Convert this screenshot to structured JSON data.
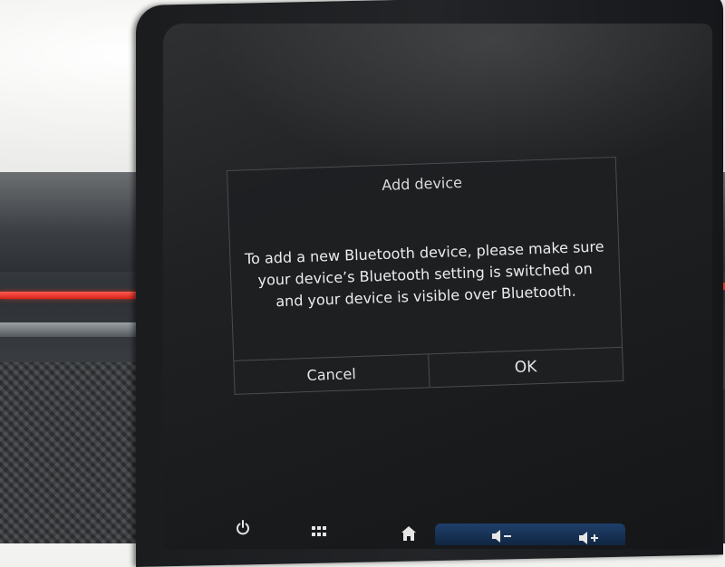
{
  "dialog": {
    "title": "Add device",
    "message": "To add a new Bluetooth device, please make sure your device’s Bluetooth setting is switched on and your device is visible over Bluetooth.",
    "cancel_label": "Cancel",
    "ok_label": "OK"
  },
  "bottom_bar": {
    "icons": [
      "power-icon",
      "grid-menu-icon",
      "home-icon",
      "volume-down-icon",
      "volume-up-icon"
    ]
  },
  "colors": {
    "accent_red": "#d8231a",
    "screen_bg": "#1f2123"
  }
}
